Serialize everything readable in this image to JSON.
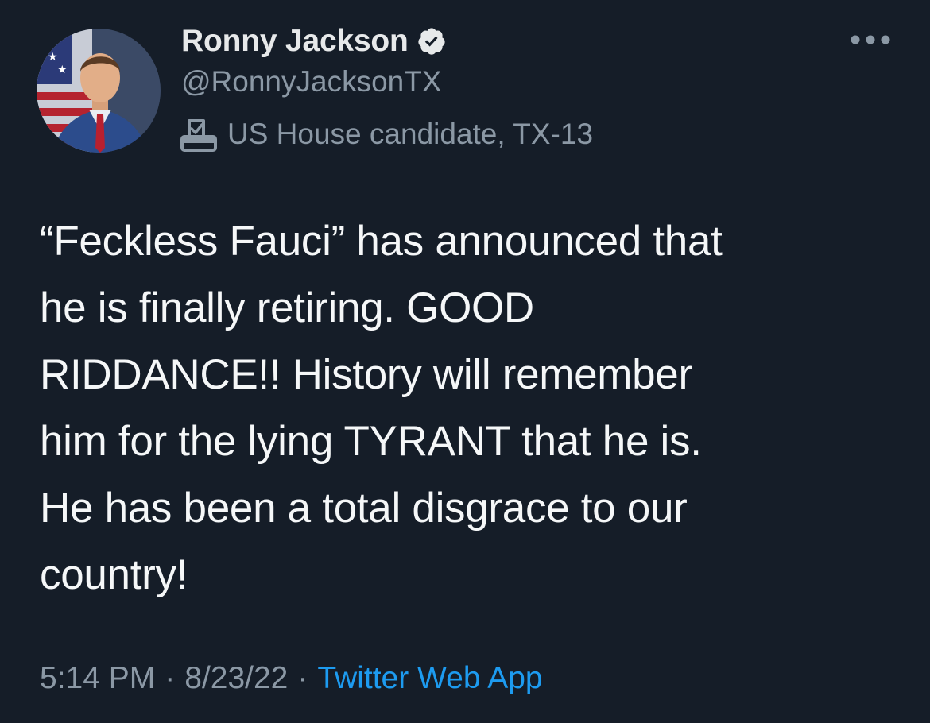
{
  "tweet": {
    "author": {
      "display_name": "Ronny Jackson",
      "handle": "@RonnyJacksonTX",
      "verified": true,
      "label": "US House candidate, TX-13",
      "label_icon": "ballot-box-icon"
    },
    "more_icon": "more-options-icon",
    "text": "“Feckless Fauci” has announced that\nhe is finally retiring. GOOD\nRIDDANCE!! History will remember\nhim for the lying TYRANT that he is.\nHe has been a total disgrace to our\ncountry!",
    "time": "5:14 PM",
    "date": "8/23/22",
    "separator": "·",
    "source": "Twitter Web App"
  },
  "colors": {
    "background": "#151d28",
    "primary_text": "#f5f7f8",
    "secondary_text": "#8b98a5",
    "link": "#1d9bf0"
  }
}
